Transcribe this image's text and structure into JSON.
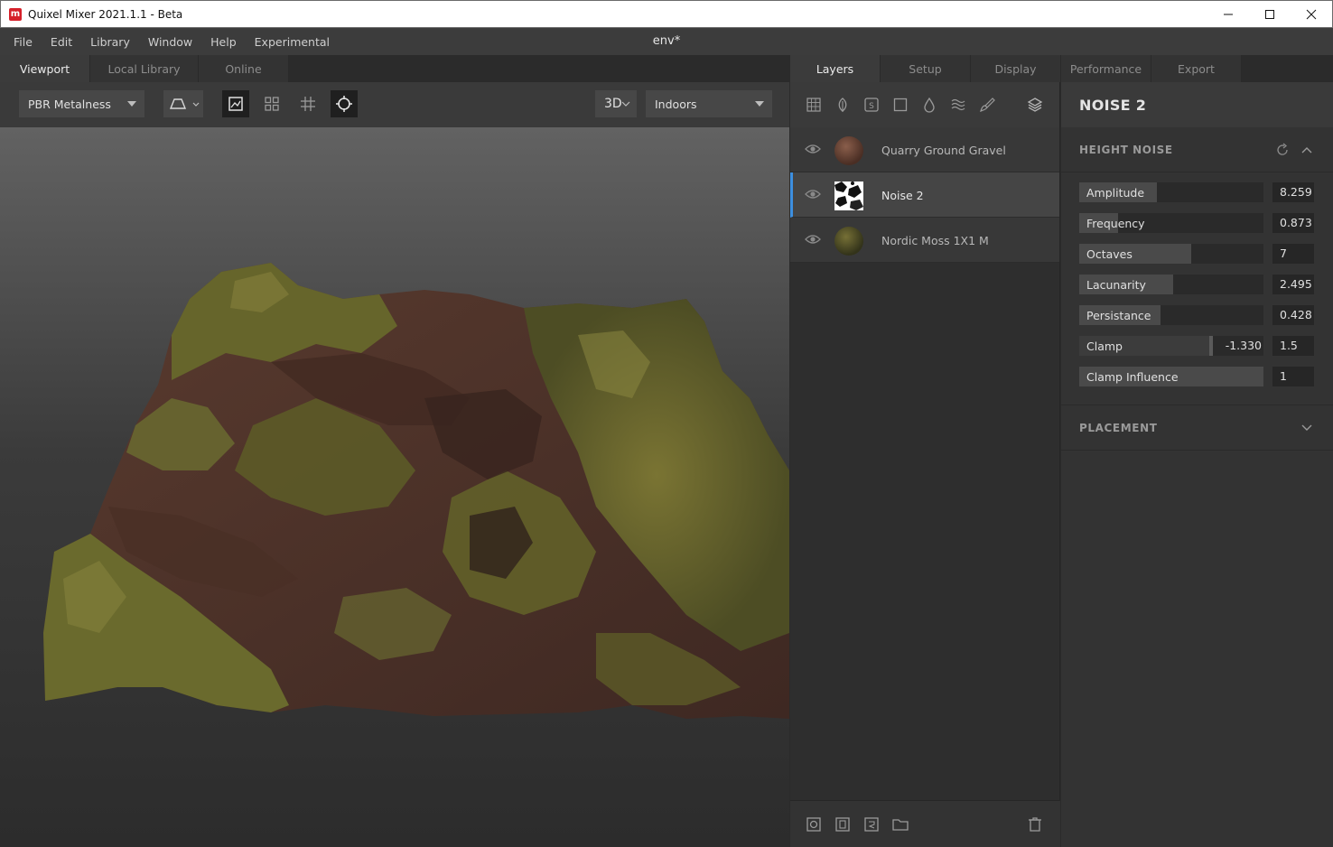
{
  "window": {
    "title": "Quixel Mixer 2021.1.1 - Beta",
    "logo_letter": "m"
  },
  "menu": [
    "File",
    "Edit",
    "Library",
    "Window",
    "Help",
    "Experimental"
  ],
  "document_title": "env*",
  "left_tabs": [
    "Viewport",
    "Local Library",
    "Online"
  ],
  "viewport_toolbar": {
    "material_mode": "PBR Metalness",
    "view_mode": "3D",
    "environment": "Indoors"
  },
  "right_tabs": [
    "Layers",
    "Setup",
    "Display",
    "Performance",
    "Export"
  ],
  "layers": [
    {
      "name": "Quarry Ground Gravel",
      "visible": true,
      "selected": false,
      "thumb_color": "#5a3a2c"
    },
    {
      "name": "Noise 2",
      "visible": true,
      "selected": true,
      "thumb_color": "#ffffff"
    },
    {
      "name": "Nordic Moss 1X1 M",
      "visible": true,
      "selected": false,
      "thumb_color": "#4f5223"
    }
  ],
  "properties": {
    "title": "NOISE 2",
    "section_height_noise": "HEIGHT NOISE",
    "params": [
      {
        "label": "Amplitude",
        "value": "8.259",
        "fill": 0.42
      },
      {
        "label": "Frequency",
        "value": "0.873",
        "fill": 0.21
      },
      {
        "label": "Octaves",
        "value": "7",
        "fill": 0.61
      },
      {
        "label": "Lacunarity",
        "value": "2.495",
        "fill": 0.51
      },
      {
        "label": "Persistance",
        "value": "0.428",
        "fill": 0.44
      },
      {
        "label": "Clamp",
        "value_min": "-1.330",
        "value": "1.5",
        "fill": 0.71
      },
      {
        "label": "Clamp Influence",
        "value": "1",
        "fill": 1.0
      }
    ],
    "section_placement": "PLACEMENT"
  },
  "colors": {
    "accent": "#3d8fe0",
    "moss": "#6d6a2f",
    "soil": "#4e3329"
  }
}
